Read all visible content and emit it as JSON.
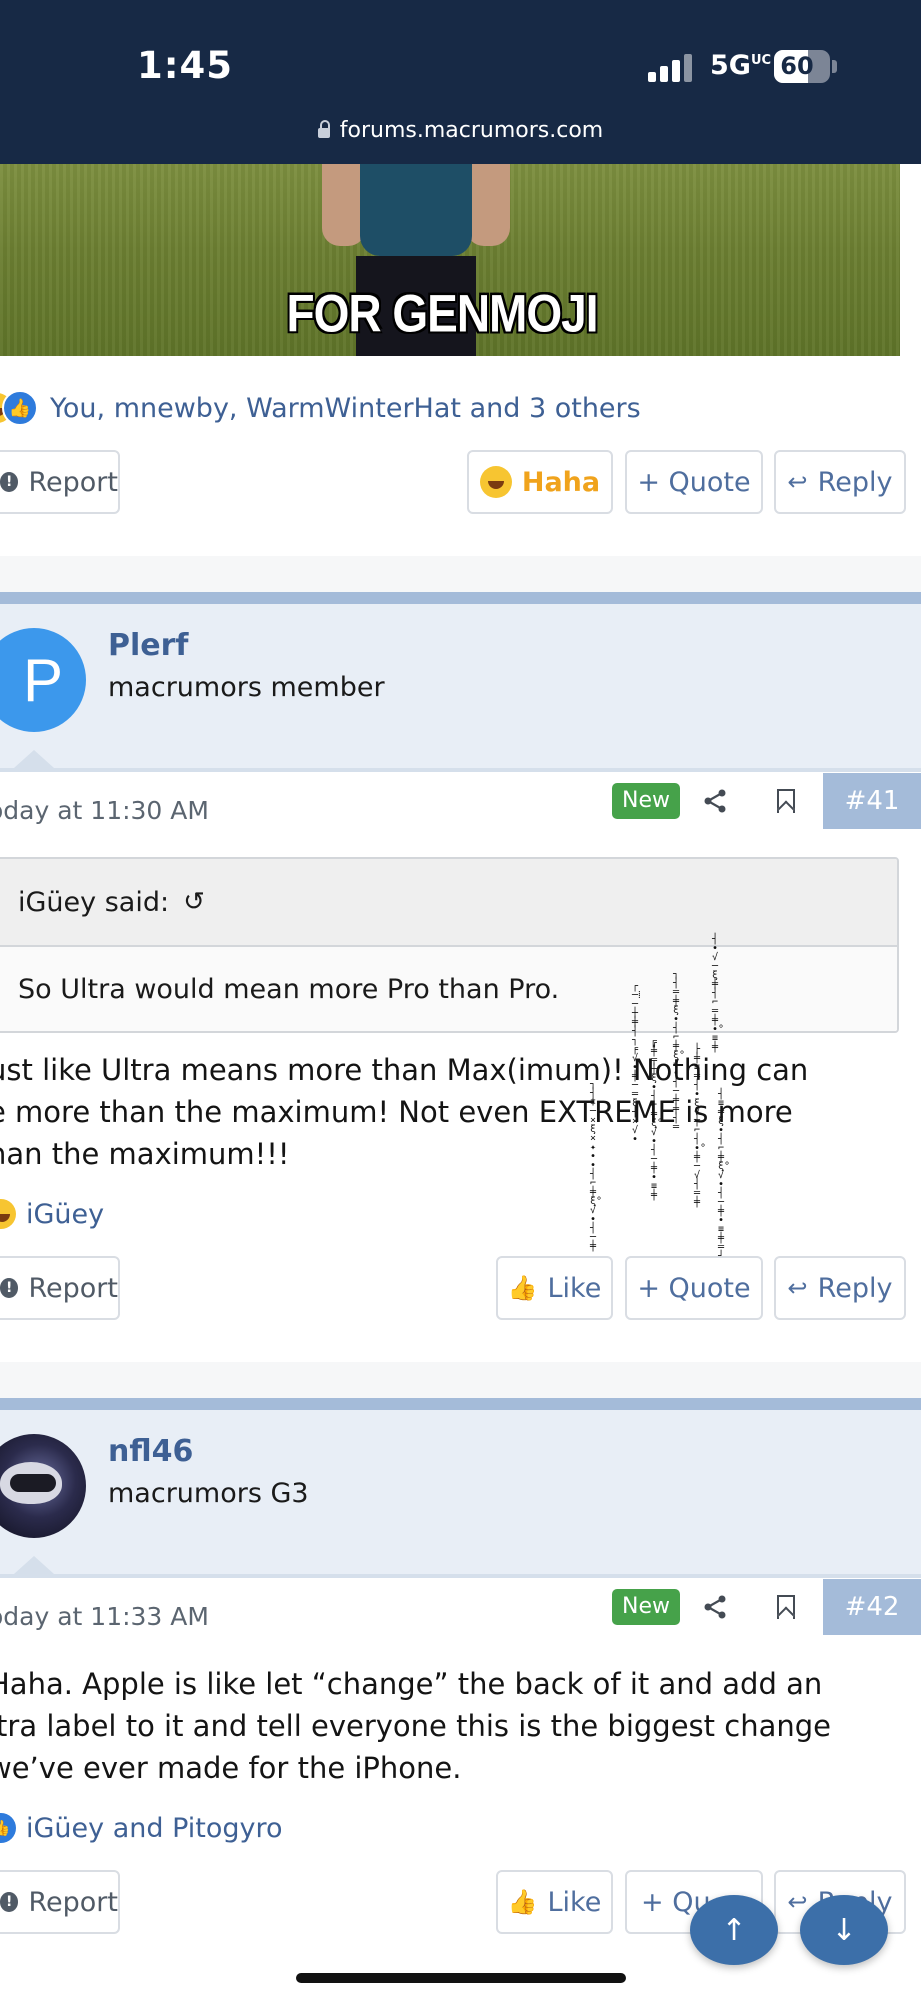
{
  "status_bar": {
    "time": "1:45",
    "network": "5G",
    "network_sub": "UC",
    "battery": "60",
    "battery_level_percent": 60
  },
  "browser": {
    "url": "forums.macrumors.com"
  },
  "image_post": {
    "image_caption": "FOR GENMOJI",
    "reactions_text": "You, mnewby, WarmWinterHat and 3 others",
    "actions": {
      "report": "Report",
      "reaction": "Haha",
      "quote": "+ Quote",
      "reply": "Reply"
    }
  },
  "posts": [
    {
      "username": "Plerf",
      "avatar_letter": "P",
      "user_title": "macrumors member",
      "date": "oday at 11:30 AM",
      "badge": "New",
      "post_number": "#41",
      "quote_author": "iGüey said:",
      "quote_text": "So Ultra would mean more Pro than Pro.",
      "body": "ust like Ultra means more than Max(imum)! Nothing can\ne more than the maximum! Not even EXTREME is more\nhan the maximum!!!",
      "likers": "iGüey",
      "actions": {
        "report": "Report",
        "like": "Like",
        "quote": "+ Quote",
        "reply": "Reply"
      }
    },
    {
      "username": "nfl46",
      "user_title": "macrumors G3",
      "date": "oday at 11:33 AM",
      "badge": "New",
      "post_number": "#42",
      "body": "Haha. Apple is like let “change” the back of it and add an\nltra label to it and tell everyone this is the biggest change\nwe’ve ever made for the iPhone.",
      "likers": "iGüey and Pitogyro",
      "actions": {
        "report": "Report",
        "like": "Like",
        "quote": "+ Qu",
        "reply": "Reply"
      }
    }
  ],
  "glitch_columns": [
    "┐┤‡─×ξ×✦∙∙┤⌐╪ξ°√∙┤─╪",
    "┌─⁞─┼╪┤┐╒√∙╪─═ξ┤×√∙",
    "╔╪╤┼ξ∙┤⌐╪ξ°√∙┤─╪∙≡╪",
    "┐┤═╪ξ∙┤⌐╪ξ°√∙┤─╪╪┤═",
    "├╪≡═┤∙ξ√╪⌐┤∙°╪─√┤═╪",
    "┤∙√─ξ╪┤⌐═╪∙°≡╪",
    "┤≡╪ξ∙┤⌐╪ξ°√∙┤─╪∙≡╪═┤"
  ],
  "scroll_buttons": {
    "up": "↑",
    "down": "↓"
  }
}
